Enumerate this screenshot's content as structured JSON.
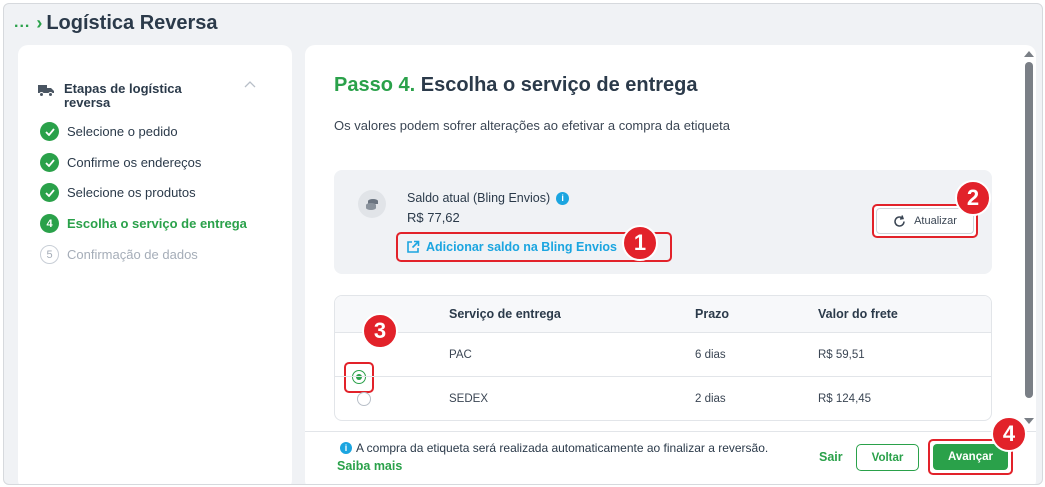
{
  "header": {
    "crumb": "...",
    "title": "Logística Reversa"
  },
  "sidebar": {
    "title": "Etapas de logística reversa",
    "steps": [
      {
        "num": "",
        "label": "Selecione o pedido",
        "state": "done"
      },
      {
        "num": "",
        "label": "Confirme os endereços",
        "state": "done"
      },
      {
        "num": "",
        "label": "Selecione os produtos",
        "state": "done"
      },
      {
        "num": "4",
        "label": "Escolha o serviço de entrega",
        "state": "current"
      },
      {
        "num": "5",
        "label": "Confirmação de dados",
        "state": "todo"
      }
    ]
  },
  "main": {
    "step_prefix": "Passo 4.",
    "title": "Escolha o serviço de entrega",
    "subtitle": "Os valores podem sofrer alterações ao efetivar a compra da etiqueta",
    "balance": {
      "label": "Saldo atual (Bling Envios)",
      "amount": "R$ 77,62",
      "add_link": "Adicionar saldo na Bling Envios",
      "refresh_label": "Atualizar"
    },
    "table": {
      "headers": [
        "",
        "Serviço de entrega",
        "Prazo",
        "Valor do frete"
      ],
      "rows": [
        {
          "service": "PAC",
          "deadline": "6 dias",
          "price": "R$ 59,51",
          "selected": true
        },
        {
          "service": "SEDEX",
          "deadline": "2 dias",
          "price": "R$ 124,45",
          "selected": false
        }
      ]
    }
  },
  "footer": {
    "note": "A compra da etiqueta será realizada automaticamente ao finalizar a reversão.",
    "learn_more": "Saiba mais",
    "exit": "Sair",
    "back": "Voltar",
    "next": "Avançar"
  },
  "annotations": [
    "1",
    "2",
    "3",
    "4"
  ],
  "colors": {
    "accent": "#2aa14a",
    "link": "#1ba5e0",
    "highlight": "#e2222a"
  }
}
